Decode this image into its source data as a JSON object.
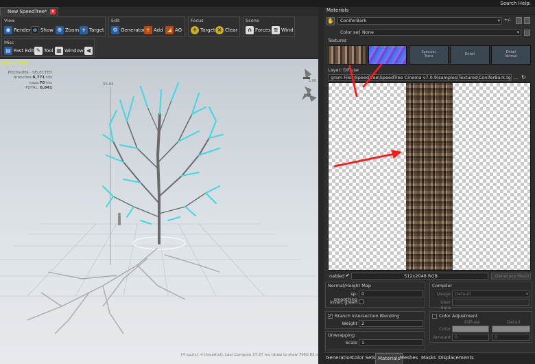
{
  "header": {
    "search_label": "Search Help:"
  },
  "document_tab": {
    "title": "New SpeedTree*",
    "close_glyph": "x"
  },
  "toolbar": {
    "view": {
      "title": "View",
      "render": "Render",
      "show": "Show",
      "zoom": "Zoom",
      "target": "Target"
    },
    "edit": {
      "title": "Edit",
      "generators": "Generators",
      "add": "Add",
      "ao": "AO"
    },
    "focus": {
      "title": "Focus",
      "target": "Target",
      "clear": "Clear"
    },
    "scene": {
      "title": "Scene",
      "forces": "Forces",
      "wind": "Wind"
    },
    "misc": {
      "title": "Misc",
      "fast_edit": "Fast Edit",
      "tool": "Tool",
      "window": "Window"
    }
  },
  "viewport": {
    "label": "perspective",
    "stats": {
      "header": "POLYGONS - SELECTED",
      "branches_label": "branches:",
      "branches_value": "8,771",
      "branches_unit": "tris",
      "caps_label": "caps:",
      "caps_value": "70",
      "caps_unit": "tris",
      "total_label": "TOTAL:",
      "total_value": "8,841"
    },
    "height_readout": "55.66",
    "light_readout": "1.00",
    "status": "[4 cpu(s), 4 thread(s)], Last Compute 17.27 ms (draw to draw 7950.83 ms)"
  },
  "materials": {
    "panel_title": "Materials",
    "material_name": "ConiferBark",
    "plus_minus": "+/-",
    "color_set_label": "Color set",
    "color_set_value": "None",
    "textures_label": "Textures",
    "texture_slots": [
      "",
      "",
      "Specular\nTrans",
      "Detail",
      "Detail\nNormal"
    ],
    "layer_label": "Layer: Diffuse",
    "file_path": "gram Files\\SpeedTree\\SpeedTree Cinema v7.0.9\\samples\\Textures\\ConiferBark.tga",
    "browse": "...",
    "enabled_label": "nabled",
    "resolution": "512x2048  RGB",
    "generate_mesh": "Generate Mesh",
    "normal_height_title": "Normal/Height Map",
    "smoothing_label": "sp. smoothing",
    "smoothing_value": "0",
    "invert_green_label": "Invert green",
    "compiler_title": "Compiler",
    "usage_label": "Usage",
    "usage_value": "Default",
    "user_data_label": "User data",
    "branch_blending_title": "Branch Intersection Blending",
    "weight_label": "Weight",
    "weight_value": "2",
    "color_adjust_title": "Color Adjustment",
    "diffuse_col": "Diffuse",
    "detail_col": "Detail",
    "color_label": "Color",
    "amount_label": "Amount",
    "amount_diffuse": "0",
    "amount_detail": "0",
    "unwrapping_title": "Unwrapping",
    "scale_label": "Scale",
    "scale_value": "1"
  },
  "bottom_tabs": [
    "Generation",
    "Color Sets",
    "Materials",
    "Meshes",
    "Masks",
    "Displacements"
  ],
  "colors": {
    "branch_highlight": "#3fd8e0",
    "trunk": "#6b6a6a",
    "accent_red": "#ff1a1a"
  }
}
